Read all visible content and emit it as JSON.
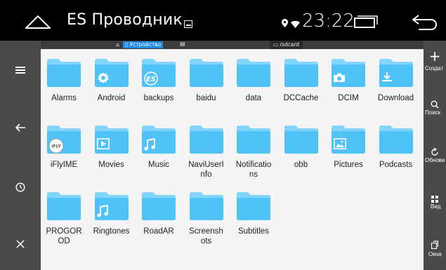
{
  "status_bar": {
    "app_title": "ES Проводник",
    "time": "23:22"
  },
  "path_bar": {
    "device_label": "Устройство",
    "sdcard_label": "/sdcard"
  },
  "files": [
    {
      "name": "Alarms",
      "badge": ""
    },
    {
      "name": "Android",
      "badge": "gear-icon"
    },
    {
      "name": "backups",
      "badge": "es-logo-icon"
    },
    {
      "name": "baidu",
      "badge": ""
    },
    {
      "name": "data",
      "badge": ""
    },
    {
      "name": "DCCache",
      "badge": ""
    },
    {
      "name": "DCIM",
      "badge": "camera-icon"
    },
    {
      "name": "Download",
      "badge": "download-icon"
    },
    {
      "name": "iFlyIME",
      "badge": "ifly-logo-icon"
    },
    {
      "name": "Movies",
      "badge": "play-icon"
    },
    {
      "name": "Music",
      "badge": "music-note-icon"
    },
    {
      "name": "NaviUserI\nnfo",
      "badge": ""
    },
    {
      "name": "Notificatio\nns",
      "badge": ""
    },
    {
      "name": "obb",
      "badge": ""
    },
    {
      "name": "Pictures",
      "badge": "picture-icon"
    },
    {
      "name": "Podcasts",
      "badge": ""
    },
    {
      "name": "PROGOR\nOD",
      "badge": ""
    },
    {
      "name": "Ringtones",
      "badge": "music-note-icon"
    },
    {
      "name": "RoadAR",
      "badge": ""
    },
    {
      "name": "Screensh\nots",
      "badge": ""
    },
    {
      "name": "Subtitles",
      "badge": ""
    }
  ],
  "right_sidebar": {
    "create_label": "Создат",
    "search_label": "Поиск",
    "refresh_label": "Обнови",
    "view_label": "Вид",
    "windows_label": "Окна"
  },
  "left_sidebar": {
    "icons": [
      "menu-icon",
      "back-arrow-icon",
      "history-icon",
      "close-icon"
    ]
  },
  "colors": {
    "folder_blue": "#4fc3f7",
    "folder_tab": "#81d4fa",
    "sidebar_bg": "#4a4a4a",
    "grid_bg": "#f4f4f4",
    "accent": "#1e88e5"
  }
}
